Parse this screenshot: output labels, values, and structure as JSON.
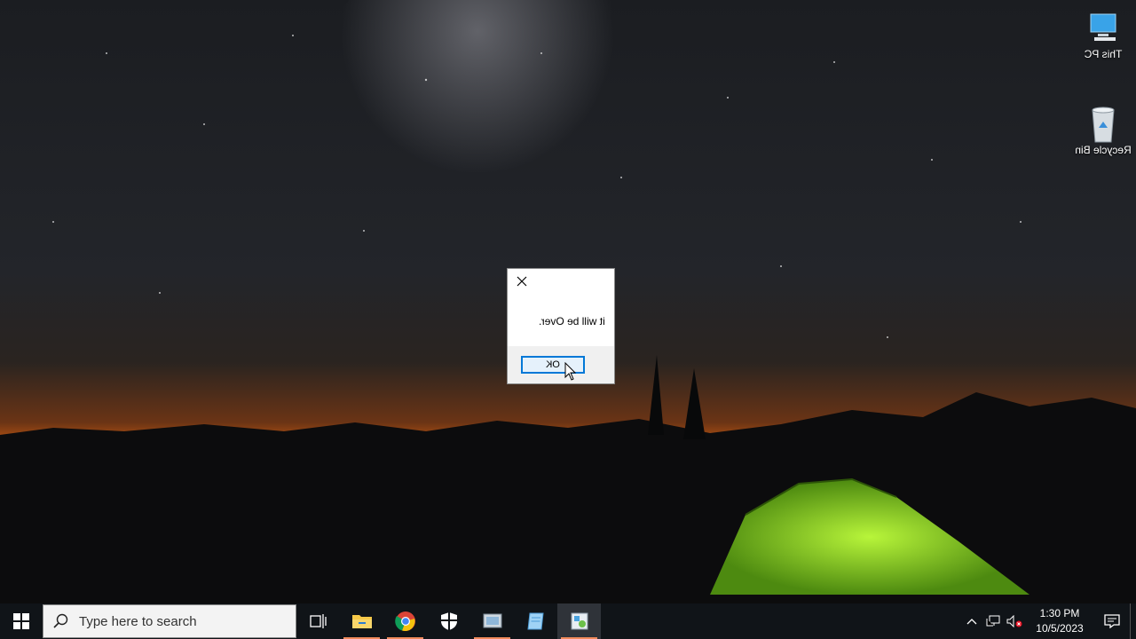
{
  "desktop": {
    "icons": [
      {
        "label": "This PC",
        "icon": "this-pc-icon"
      },
      {
        "label": "Recycle Bin",
        "icon": "recycle-bin-icon"
      }
    ]
  },
  "dialog": {
    "message": "it will be Over.",
    "ok_label": "OK",
    "close_icon": "close-icon"
  },
  "taskbar": {
    "search_placeholder": "Type here to search",
    "apps": [
      {
        "name": "task-view",
        "icon": "task-view-icon"
      },
      {
        "name": "file-explorer",
        "icon": "folder-icon"
      },
      {
        "name": "chrome",
        "icon": "chrome-icon"
      },
      {
        "name": "windows-security",
        "icon": "shield-icon"
      },
      {
        "name": "app-1",
        "icon": "app-icon"
      },
      {
        "name": "app-2",
        "icon": "notepad-icon"
      },
      {
        "name": "app-3",
        "icon": "app-icon"
      }
    ],
    "clock": {
      "time": "1:30 PM",
      "date": "10/5/2023"
    }
  },
  "colors": {
    "accent": "#0078d7",
    "taskbar": "#101418",
    "running_indicator": "#f28b5c"
  }
}
